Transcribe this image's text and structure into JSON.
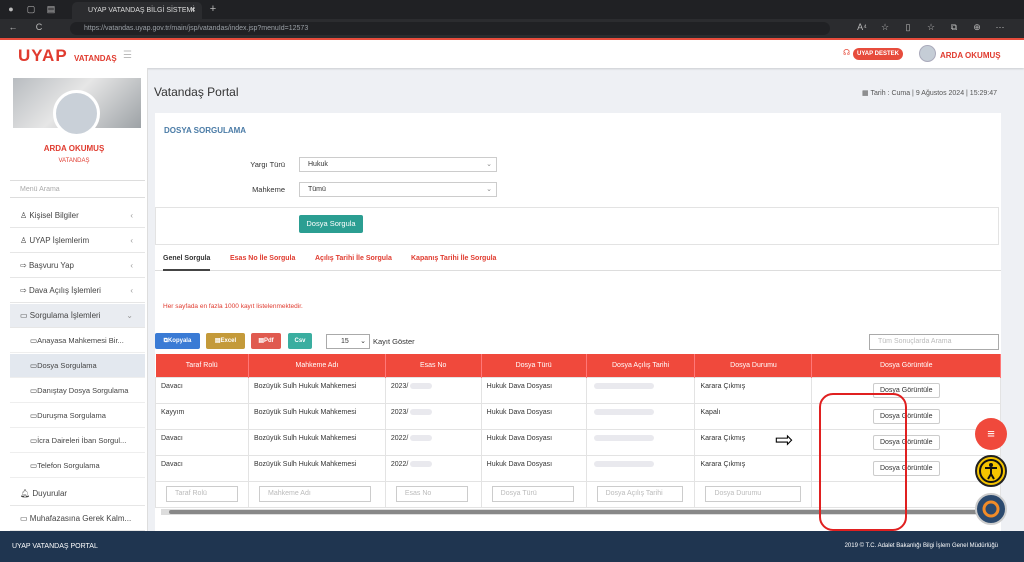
{
  "browser": {
    "tab_title": "UYAP VATANDAŞ BİLGİ SİSTEMİ",
    "url": "https://vatandas.uyap.gov.tr/main/jsp/vatandas/index.jsp?menuId=12573",
    "new_tab": "+",
    "back": "←",
    "reload": "C",
    "nav_icons": [
      "A⁴",
      "☆",
      "▯",
      "☆",
      "⧉",
      "⊕",
      "⋯"
    ]
  },
  "header": {
    "logo": "UYAP",
    "logo_sub": "VATANDAŞ",
    "menu_icon": "☰",
    "support": "UYAP DESTEK",
    "user": "ARDA OKUMUŞ"
  },
  "sidebar": {
    "name": "ARDA OKUMUŞ",
    "role": "VATANDAŞ",
    "search_placeholder": "Menü Arama",
    "menu": [
      {
        "label": "Kişisel Bilgiler",
        "icon": "user-icon"
      },
      {
        "label": "UYAP İşlemlerim",
        "icon": "users-icon"
      },
      {
        "label": "Başvuru Yap",
        "icon": "send-icon"
      },
      {
        "label": "Dava Açılış İşlemleri",
        "icon": "send-icon"
      },
      {
        "label": "Sorgulama İşlemleri",
        "icon": "folder-icon"
      }
    ],
    "submenu": [
      "Anayasa Mahkemesi Bir...",
      "Dosya Sorgulama",
      "Danıştay Dosya Sorgulama",
      "Duruşma Sorgulama",
      "İcra Daireleri İban Sorgul...",
      "Telefon Sorgulama"
    ],
    "bottom": [
      "Duyurular",
      "Muhafazasına Gerek Kalm..."
    ],
    "chevron": "‹",
    "chevron_open": "⌄"
  },
  "page": {
    "title": "Vatandaş Portal",
    "date": "Tarih : Cuma | 9 Ağustos 2024 | 15:29:47",
    "card_title": "DOSYA SORGULAMA",
    "yargi_label": "Yargı Türü",
    "yargi_value": "Hukuk",
    "mahkeme_label": "Mahkeme",
    "mahkeme_value": "Tümü",
    "query_button": "Dosya Sorgula",
    "tabs": [
      "Genel Sorgula",
      "Esas No İle Sorgula",
      "Açılış Tarihi İle Sorgula",
      "Kapanış Tarihi İle Sorgula"
    ],
    "warning": "Her sayfada en fazla 1000 kayıt listelenmektedir.",
    "export": [
      "Kopyala",
      "Excel",
      "Pdf",
      "Csv"
    ],
    "page_size": "15",
    "show_label": "Kayıt Göster",
    "global_search": "Tüm Sonuçlarda Arama"
  },
  "table": {
    "headers": [
      "Taraf Rolü",
      "Mahkeme Adı",
      "Esas No",
      "Dosya Türü",
      "Dosya Açılış Tarihi",
      "Dosya Durumu",
      "Dosya Görüntüle"
    ],
    "rows": [
      [
        "Davacı",
        "Bozüyük Sulh Hukuk Mahkemesi",
        "2023/",
        "Hukuk Dava Dosyası",
        "",
        "Karara Çıkmış",
        "Dosya Görüntüle"
      ],
      [
        "Kayyım",
        "Bozüyük Sulh Hukuk Mahkemesi",
        "2023/",
        "Hukuk Dava Dosyası",
        "",
        "Kapalı",
        "Dosya Görüntüle"
      ],
      [
        "Davacı",
        "Bozüyük Sulh Hukuk Mahkemesi",
        "2022/",
        "Hukuk Dava Dosyası",
        "",
        "Karara Çıkmış",
        "Dosya Görüntüle"
      ],
      [
        "Davacı",
        "Bozüyük Sulh Hukuk Mahkemesi",
        "2022/",
        "Hukuk Dava Dosyası",
        "",
        "Karara Çıkmış",
        "Dosya Görüntüle"
      ]
    ],
    "filters": [
      "Taraf Rolü",
      "Mahkeme Adı",
      "Esas No",
      "Dosya Türü",
      "Dosya Açılış Tarihi",
      "Dosya Durumu"
    ]
  },
  "fab": {
    "menu": "≡"
  },
  "footer": {
    "left": "UYAP VATANDAŞ PORTAL",
    "right": "2019 © T.C. Adalet Bakanlığı Bilgi İşlem Genel Müdürlüğü"
  },
  "colors": {
    "accent": "#e03b2f",
    "teal": "#2b9e92",
    "footer": "#1f3550"
  }
}
